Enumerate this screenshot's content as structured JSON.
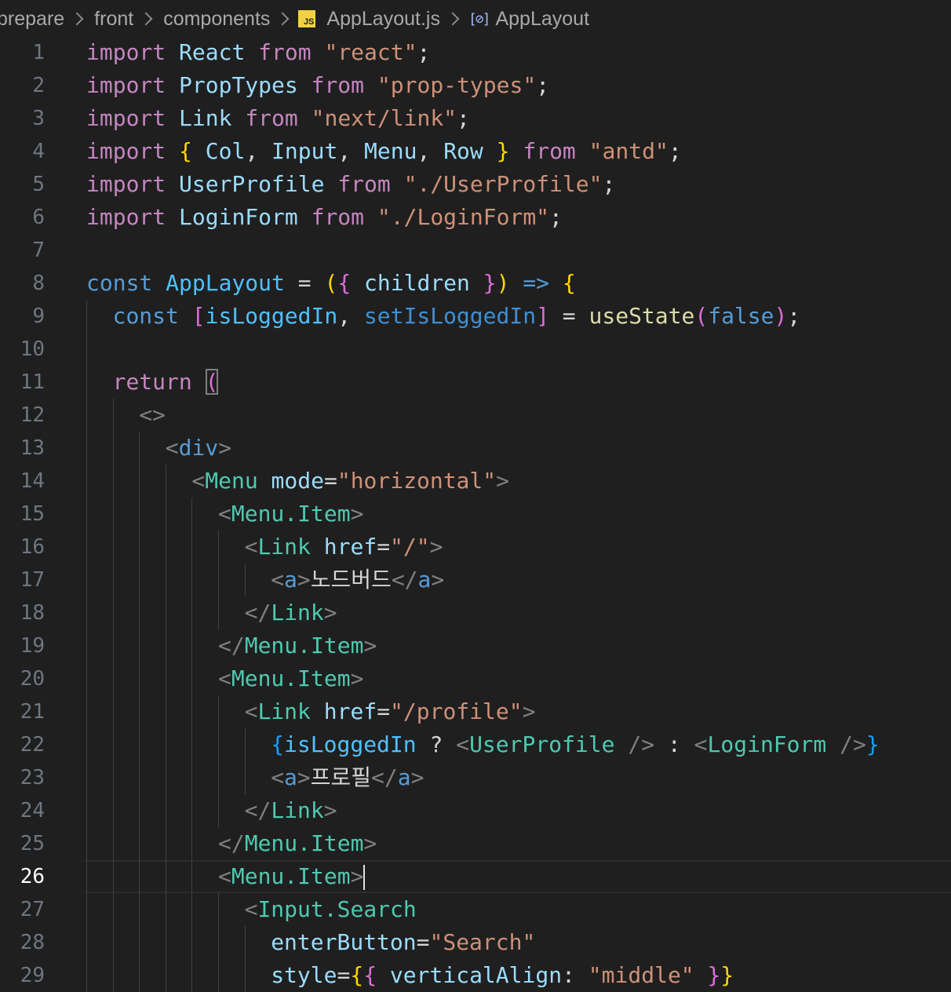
{
  "breadcrumb": {
    "items": [
      "prepare",
      "front",
      "components"
    ],
    "file_badge": "JS",
    "file": "AppLayout.js",
    "symbol_icon": "symbol-variable-icon",
    "symbol": "AppLayout"
  },
  "editor": {
    "current_line": 26,
    "lines": [
      {
        "n": "1",
        "indent": 0,
        "tokens": [
          [
            "import",
            "kw"
          ],
          [
            " ",
            "plain"
          ],
          [
            "React",
            "var"
          ],
          [
            " ",
            "plain"
          ],
          [
            "from",
            "kw"
          ],
          [
            " ",
            "plain"
          ],
          [
            "\"react\"",
            "str"
          ],
          [
            ";",
            "punc"
          ]
        ]
      },
      {
        "n": "2",
        "indent": 0,
        "tokens": [
          [
            "import",
            "kw"
          ],
          [
            " ",
            "plain"
          ],
          [
            "PropTypes",
            "var"
          ],
          [
            " ",
            "plain"
          ],
          [
            "from",
            "kw"
          ],
          [
            " ",
            "plain"
          ],
          [
            "\"prop-types\"",
            "str"
          ],
          [
            ";",
            "punc"
          ]
        ]
      },
      {
        "n": "3",
        "indent": 0,
        "tokens": [
          [
            "import",
            "kw"
          ],
          [
            " ",
            "plain"
          ],
          [
            "Link",
            "var"
          ],
          [
            " ",
            "plain"
          ],
          [
            "from",
            "kw"
          ],
          [
            " ",
            "plain"
          ],
          [
            "\"next/link\"",
            "str"
          ],
          [
            ";",
            "punc"
          ]
        ]
      },
      {
        "n": "4",
        "indent": 0,
        "tokens": [
          [
            "import",
            "kw"
          ],
          [
            " ",
            "plain"
          ],
          [
            "{",
            "b1"
          ],
          [
            " ",
            "plain"
          ],
          [
            "Col",
            "var"
          ],
          [
            ", ",
            "punc"
          ],
          [
            "Input",
            "var"
          ],
          [
            ", ",
            "punc"
          ],
          [
            "Menu",
            "var"
          ],
          [
            ", ",
            "punc"
          ],
          [
            "Row",
            "var"
          ],
          [
            " ",
            "plain"
          ],
          [
            "}",
            "b1"
          ],
          [
            " ",
            "plain"
          ],
          [
            "from",
            "kw"
          ],
          [
            " ",
            "plain"
          ],
          [
            "\"antd\"",
            "str"
          ],
          [
            ";",
            "punc"
          ]
        ]
      },
      {
        "n": "5",
        "indent": 0,
        "tokens": [
          [
            "import",
            "kw"
          ],
          [
            " ",
            "plain"
          ],
          [
            "UserProfile",
            "var"
          ],
          [
            " ",
            "plain"
          ],
          [
            "from",
            "kw"
          ],
          [
            " ",
            "plain"
          ],
          [
            "\"./UserProfile\"",
            "str"
          ],
          [
            ";",
            "punc"
          ]
        ]
      },
      {
        "n": "6",
        "indent": 0,
        "tokens": [
          [
            "import",
            "kw"
          ],
          [
            " ",
            "plain"
          ],
          [
            "LoginForm",
            "var"
          ],
          [
            " ",
            "plain"
          ],
          [
            "from",
            "kw"
          ],
          [
            " ",
            "plain"
          ],
          [
            "\"./LoginForm\"",
            "str"
          ],
          [
            ";",
            "punc"
          ]
        ]
      },
      {
        "n": "7",
        "indent": 0,
        "tokens": []
      },
      {
        "n": "8",
        "indent": 0,
        "tokens": [
          [
            "const",
            "kw-blue"
          ],
          [
            " ",
            "plain"
          ],
          [
            "AppLayout",
            "fn-blue"
          ],
          [
            " = ",
            "punc"
          ],
          [
            "(",
            "b1"
          ],
          [
            "{",
            "b2"
          ],
          [
            " ",
            "plain"
          ],
          [
            "children",
            "var"
          ],
          [
            " ",
            "plain"
          ],
          [
            "}",
            "b2"
          ],
          [
            ")",
            "b1"
          ],
          [
            " ",
            "plain"
          ],
          [
            "=>",
            "kw-blue"
          ],
          [
            " ",
            "plain"
          ],
          [
            "{",
            "b1"
          ]
        ]
      },
      {
        "n": "9",
        "indent": 1,
        "tokens": [
          [
            "const",
            "kw-blue"
          ],
          [
            " ",
            "plain"
          ],
          [
            "[",
            "b2"
          ],
          [
            "isLoggedIn",
            "const"
          ],
          [
            ", ",
            "punc"
          ],
          [
            "setIsLoggedIn",
            "fn-blue2"
          ],
          [
            "]",
            "b2"
          ],
          [
            " = ",
            "punc"
          ],
          [
            "useState",
            "fn"
          ],
          [
            "(",
            "b2"
          ],
          [
            "false",
            "bool"
          ],
          [
            ")",
            "b2"
          ],
          [
            ";",
            "punc"
          ]
        ]
      },
      {
        "n": "10",
        "indent": 1,
        "tokens": []
      },
      {
        "n": "11",
        "indent": 1,
        "tokens": [
          [
            "return",
            "kw"
          ],
          [
            " ",
            "plain"
          ],
          [
            "(",
            "b2-box"
          ]
        ]
      },
      {
        "n": "12",
        "indent": 2,
        "tokens": [
          [
            "<>",
            "tag"
          ]
        ]
      },
      {
        "n": "13",
        "indent": 3,
        "tokens": [
          [
            "<",
            "tag"
          ],
          [
            "div",
            "html"
          ],
          [
            ">",
            "tag"
          ]
        ]
      },
      {
        "n": "14",
        "indent": 4,
        "tokens": [
          [
            "<",
            "tag"
          ],
          [
            "Menu",
            "comp"
          ],
          [
            " ",
            "plain"
          ],
          [
            "mode",
            "attr"
          ],
          [
            "=",
            "punc"
          ],
          [
            "\"horizontal\"",
            "str"
          ],
          [
            ">",
            "tag"
          ]
        ]
      },
      {
        "n": "15",
        "indent": 5,
        "tokens": [
          [
            "<",
            "tag"
          ],
          [
            "Menu.Item",
            "comp"
          ],
          [
            ">",
            "tag"
          ]
        ]
      },
      {
        "n": "16",
        "indent": 6,
        "tokens": [
          [
            "<",
            "tag"
          ],
          [
            "Link",
            "comp"
          ],
          [
            " ",
            "plain"
          ],
          [
            "href",
            "attr"
          ],
          [
            "=",
            "punc"
          ],
          [
            "\"/\"",
            "str"
          ],
          [
            ">",
            "tag"
          ]
        ]
      },
      {
        "n": "17",
        "indent": 7,
        "tokens": [
          [
            "<",
            "tag"
          ],
          [
            "a",
            "html"
          ],
          [
            ">",
            "tag"
          ],
          [
            "노드버드",
            "plain"
          ],
          [
            "</",
            "tag"
          ],
          [
            "a",
            "html"
          ],
          [
            ">",
            "tag"
          ]
        ]
      },
      {
        "n": "18",
        "indent": 6,
        "tokens": [
          [
            "</",
            "tag"
          ],
          [
            "Link",
            "comp"
          ],
          [
            ">",
            "tag"
          ]
        ]
      },
      {
        "n": "19",
        "indent": 5,
        "tokens": [
          [
            "</",
            "tag"
          ],
          [
            "Menu.Item",
            "comp"
          ],
          [
            ">",
            "tag"
          ]
        ]
      },
      {
        "n": "20",
        "indent": 5,
        "tokens": [
          [
            "<",
            "tag"
          ],
          [
            "Menu.Item",
            "comp"
          ],
          [
            ">",
            "tag"
          ]
        ]
      },
      {
        "n": "21",
        "indent": 6,
        "tokens": [
          [
            "<",
            "tag"
          ],
          [
            "Link",
            "comp"
          ],
          [
            " ",
            "plain"
          ],
          [
            "href",
            "attr"
          ],
          [
            "=",
            "punc"
          ],
          [
            "\"/profile\"",
            "str"
          ],
          [
            ">",
            "tag"
          ]
        ]
      },
      {
        "n": "22",
        "indent": 7,
        "tokens": [
          [
            "{",
            "b3"
          ],
          [
            "isLoggedIn",
            "const"
          ],
          [
            " ? ",
            "punc"
          ],
          [
            "<",
            "tag"
          ],
          [
            "UserProfile",
            "comp"
          ],
          [
            " />",
            "tag"
          ],
          [
            " : ",
            "punc"
          ],
          [
            "<",
            "tag"
          ],
          [
            "LoginForm",
            "comp"
          ],
          [
            " />",
            "tag"
          ],
          [
            "}",
            "b3"
          ]
        ]
      },
      {
        "n": "23",
        "indent": 7,
        "tokens": [
          [
            "<",
            "tag"
          ],
          [
            "a",
            "html"
          ],
          [
            ">",
            "tag"
          ],
          [
            "프로필",
            "plain"
          ],
          [
            "</",
            "tag"
          ],
          [
            "a",
            "html"
          ],
          [
            ">",
            "tag"
          ]
        ]
      },
      {
        "n": "24",
        "indent": 6,
        "tokens": [
          [
            "</",
            "tag"
          ],
          [
            "Link",
            "comp"
          ],
          [
            ">",
            "tag"
          ]
        ]
      },
      {
        "n": "25",
        "indent": 5,
        "tokens": [
          [
            "</",
            "tag"
          ],
          [
            "Menu.Item",
            "comp"
          ],
          [
            ">",
            "tag"
          ]
        ]
      },
      {
        "n": "26",
        "indent": 5,
        "tokens": [
          [
            "<",
            "tag"
          ],
          [
            "Menu.Item",
            "comp"
          ],
          [
            ">",
            "tag"
          ]
        ],
        "caret": true
      },
      {
        "n": "27",
        "indent": 6,
        "tokens": [
          [
            "<",
            "tag"
          ],
          [
            "Input.Search",
            "comp"
          ]
        ]
      },
      {
        "n": "28",
        "indent": 7,
        "tokens": [
          [
            "enterButton",
            "attr"
          ],
          [
            "=",
            "punc"
          ],
          [
            "\"Search\"",
            "str"
          ]
        ]
      },
      {
        "n": "29",
        "indent": 7,
        "tokens": [
          [
            "style",
            "attr"
          ],
          [
            "=",
            "punc"
          ],
          [
            "{",
            "b1"
          ],
          [
            "{",
            "b2"
          ],
          [
            " ",
            "plain"
          ],
          [
            "verticalAlign",
            "attr"
          ],
          [
            ": ",
            "punc"
          ],
          [
            "\"middle\"",
            "str"
          ],
          [
            " ",
            "plain"
          ],
          [
            "}",
            "b2"
          ],
          [
            "}",
            "b1"
          ]
        ]
      }
    ]
  }
}
